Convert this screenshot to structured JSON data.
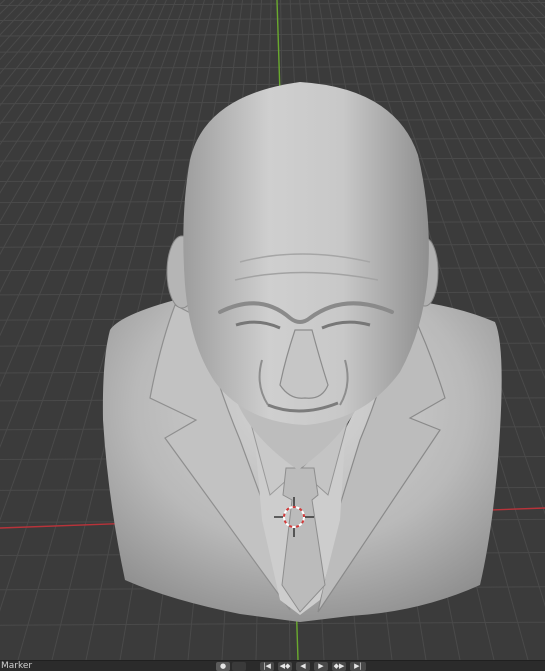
{
  "app": "Blender 3D Viewport",
  "viewport": {
    "model": "sculpted-bust",
    "background_color": "#3b3b3b",
    "grid_color": "#4a4a4a",
    "x_axis_color": "#b8333a",
    "y_axis_color": "#6aaa2e",
    "clay_color": "#bdbdbd",
    "cursor_icon": "3d-cursor-icon"
  },
  "timeline": {
    "marker_label": "Marker",
    "keyframe_icon": "●",
    "keyframe_toggle_icon": "",
    "jump_start_icon": "|◀",
    "prev_key_icon": "◀◆",
    "play_reverse_icon": "◀",
    "play_icon": "▶",
    "next_key_icon": "◆▶",
    "jump_end_icon": "▶|"
  }
}
